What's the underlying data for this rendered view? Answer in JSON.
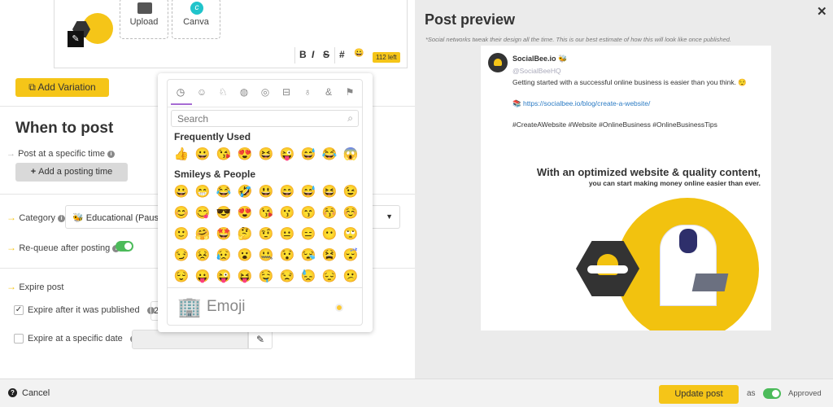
{
  "editor": {
    "upload_label": "Upload",
    "canva_label": "Canva",
    "bold": "B",
    "italic": "I",
    "strike": "S",
    "hashtag": "#",
    "chars_left": "112 left"
  },
  "add_variation": "Add Variation",
  "when": {
    "title": "When to post",
    "specific_time": "Post at a specific time",
    "add_time": "Add a posting time"
  },
  "category": {
    "label": "Category",
    "value": "Educational (Paused)"
  },
  "requeue": {
    "label": "Re-queue after posting",
    "on": true
  },
  "expire": {
    "label": "Expire post",
    "after_published": "Expire after it was published",
    "after_published_checked": true,
    "after_value": "2",
    "specific_date": "Expire at a specific date",
    "specific_date_checked": false
  },
  "picker": {
    "search_placeholder": "Search",
    "frequent_title": "Frequently Used",
    "smileys_title": "Smileys & People",
    "frequent": [
      "👍",
      "😀",
      "😘",
      "😍",
      "😆",
      "😜",
      "😅",
      "😂",
      "😱"
    ],
    "smileys": [
      [
        "😀",
        "😁",
        "😂",
        "🤣",
        "😃",
        "😄",
        "😅",
        "😆",
        "😉"
      ],
      [
        "😊",
        "😋",
        "😎",
        "😍",
        "😘",
        "😗",
        "😙",
        "😚",
        "☺️"
      ],
      [
        "🙂",
        "🤗",
        "🤩",
        "🤔",
        "🤨",
        "😐",
        "😑",
        "😶",
        "🙄"
      ],
      [
        "😏",
        "😣",
        "😥",
        "😮",
        "🤐",
        "😯",
        "😪",
        "😫",
        "😴"
      ],
      [
        "😌",
        "😛",
        "😜",
        "😝",
        "🤤",
        "😒",
        "😓",
        "😔",
        "😕"
      ]
    ],
    "footer_emoji": "🏢",
    "footer_label": "Emoji"
  },
  "preview": {
    "title": "Post preview",
    "note": "*Social networks tweak their design all the time. This is our best estimate of how this will look like once published.",
    "name": "SocialBee.io 🐝",
    "handle": "@SocialBeeHQ",
    "text": "Getting started with a successful online business is easier than you think. 😌",
    "link_emoji": "📚",
    "link": "https://socialbee.io/blog/create-a-website/",
    "hashtags": "#CreateAWebsite #Website #OnlineBusiness #OnlineBusinessTips",
    "image_headline": "With an optimized website & quality content,",
    "image_sub": "you can start making money online easier than ever."
  },
  "footer": {
    "cancel": "Cancel",
    "update": "Update post",
    "as": "as",
    "status": "Approved"
  }
}
